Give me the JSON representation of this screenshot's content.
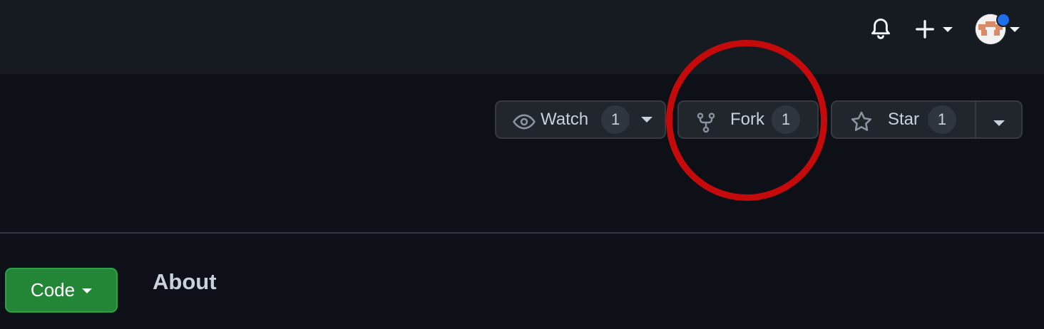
{
  "header": {
    "notifications_icon": "bell-icon",
    "create_icon": "plus-icon",
    "avatar_icon": "user-avatar",
    "notification_dot_color": "#1f6feb"
  },
  "repo_actions": {
    "watch": {
      "label": "Watch",
      "count": "1",
      "icon": "eye-icon"
    },
    "fork": {
      "label": "Fork",
      "count": "1",
      "icon": "repo-forked-icon"
    },
    "star": {
      "label": "Star",
      "count": "1",
      "icon": "star-icon"
    }
  },
  "code_button": {
    "label": "Code",
    "color": "#238636"
  },
  "sidebar": {
    "about_heading": "About"
  },
  "annotation": {
    "highlight_color": "#c40a0a",
    "highlighted": "fork-button"
  }
}
